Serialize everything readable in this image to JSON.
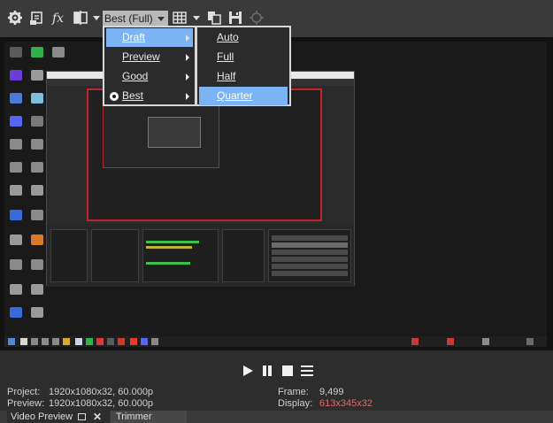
{
  "toolbar": {
    "quality_value": "Best (Full)",
    "icons": [
      "gear-icon",
      "device-icon",
      "fx-icon",
      "split-screen-icon",
      "grid-icon",
      "copy-snapshot-icon",
      "save-snapshot-icon",
      "external-monitor-icon"
    ]
  },
  "quality_menu": {
    "items": [
      {
        "label": "Draft",
        "highlighted": true
      },
      {
        "label": "Preview",
        "highlighted": false
      },
      {
        "label": "Good",
        "highlighted": false
      },
      {
        "label": "Best",
        "highlighted": false,
        "selected": true
      }
    ]
  },
  "draft_submenu": {
    "items": [
      {
        "label": "Auto"
      },
      {
        "label": "Full"
      },
      {
        "label": "Half"
      },
      {
        "label": "Quarter",
        "highlighted": true
      }
    ]
  },
  "status": {
    "project_label": "Project:",
    "project_value": "1920x1080x32, 60.000p",
    "preview_label": "Preview:",
    "preview_value": "1920x1080x32, 60.000p",
    "frame_label": "Frame:",
    "frame_value": "9,499",
    "display_label": "Display:",
    "display_value": "613x345x32"
  },
  "tabs": {
    "video_preview": "Video Preview",
    "trimmer": "Trimmer"
  },
  "colors": {
    "accent_highlight": "#7cb3f4",
    "display_value": "#e06a6a",
    "obs_border": "#c0242f"
  }
}
